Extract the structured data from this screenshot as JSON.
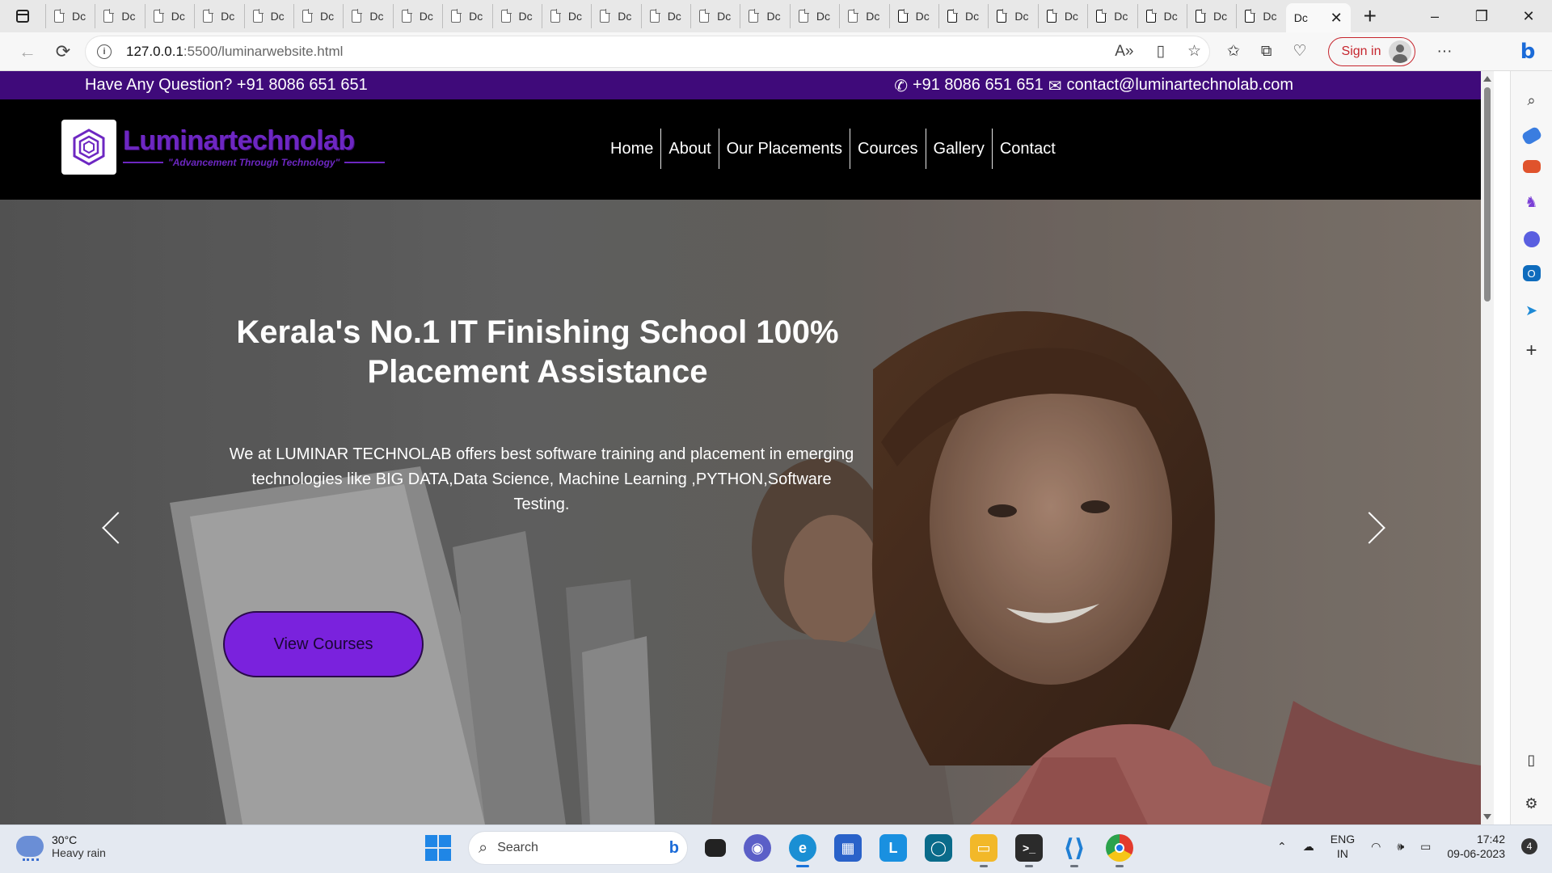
{
  "browser": {
    "tab_label": "Dc",
    "tab_count": 25,
    "active_tab_label": "Dc",
    "url_host": "127.0.0.1",
    "url_path": ":5500/luminarwebsite.html",
    "sign_in_label": "Sign in",
    "window_controls": [
      "–",
      "❐",
      "✕"
    ]
  },
  "site": {
    "topbar": {
      "question": "Have Any Question? +91 8086 651 651",
      "phone": "+91 8086 651 651",
      "email": "contact@luminartechnolab.com"
    },
    "logo": {
      "name": "Luminartechnolab",
      "tagline": "\"Advancement Through Technology\""
    },
    "nav": [
      "Home",
      "About",
      "Our Placements",
      "Cources",
      "Gallery",
      "Contact"
    ],
    "hero": {
      "title": "Kerala's No.1 IT Finishing School 100% Placement Assistance",
      "description": "We at LUMINAR TECHNOLAB offers best software training and placement in emerging technologies like BIG DATA,Data Science, Machine Learning ,PYTHON,Software Testing.",
      "cta_label": "View Courses"
    },
    "colors": {
      "topbar": "#3f0a7a",
      "brand_purple": "#6d27c2",
      "cta": "#7a22dd",
      "nav_bg": "#000000"
    }
  },
  "taskbar": {
    "weather_temp": "30°C",
    "weather_cond": "Heavy rain",
    "search_label": "Search",
    "lang_top": "ENG",
    "lang_bottom": "IN",
    "time": "17:42",
    "date": "09-06-2023",
    "notification_count": "4"
  }
}
